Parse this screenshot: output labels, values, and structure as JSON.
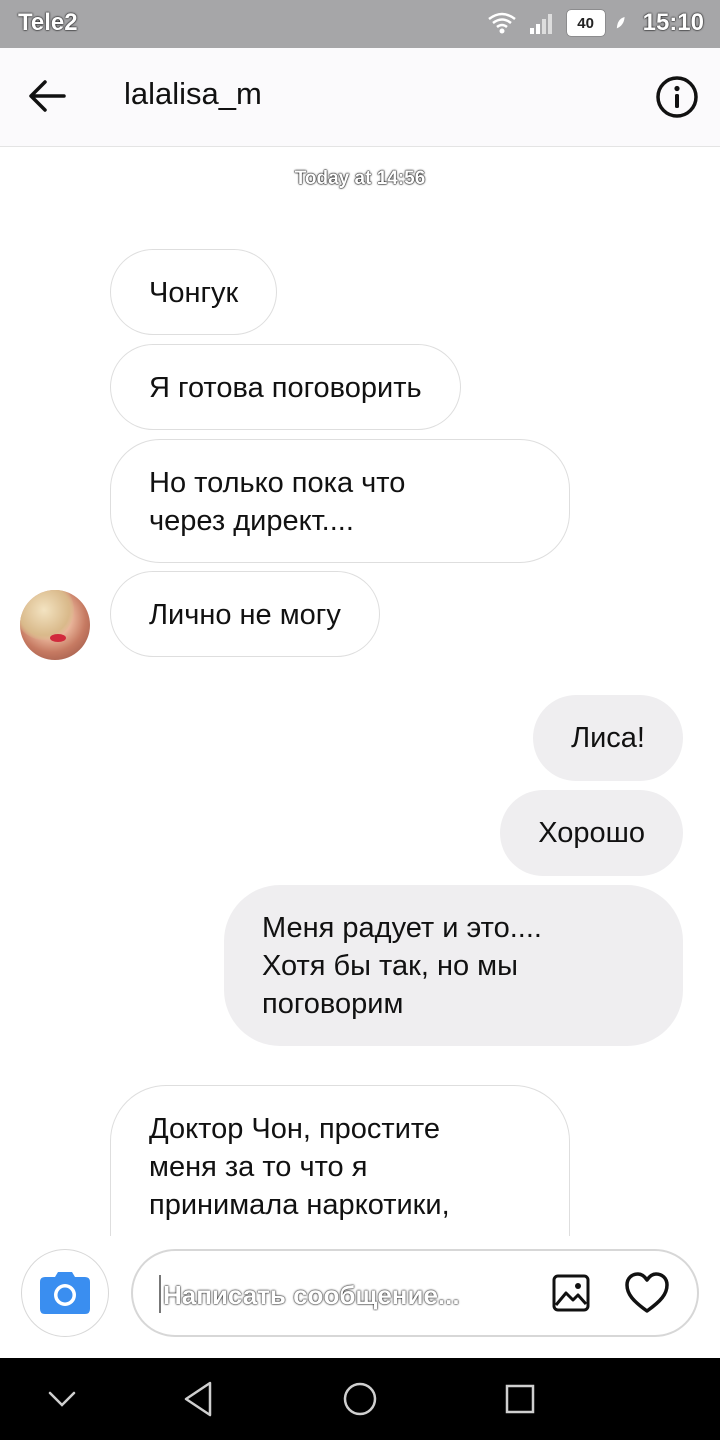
{
  "status_bar": {
    "carrier": "Tele2",
    "signal_badge": "40",
    "time": "15:10",
    "icons": [
      "wifi-icon",
      "signal-icon",
      "battery-icon",
      "leaf-icon"
    ]
  },
  "header": {
    "title": "lalalisa_m",
    "icons": [
      "back-arrow-icon",
      "info-icon"
    ]
  },
  "timestamp": "Today at 14:56",
  "messages": [
    {
      "direction": "incoming",
      "text": "Чонгук"
    },
    {
      "direction": "incoming",
      "text": "Я готова поговорить"
    },
    {
      "direction": "incoming",
      "text": "Но только пока что\nчерез директ...."
    },
    {
      "direction": "incoming",
      "text": "Лично не могу"
    },
    {
      "direction": "outgoing",
      "text": "Лиса!"
    },
    {
      "direction": "outgoing",
      "text": "Хорошо"
    },
    {
      "direction": "outgoing",
      "text": "Меня радует и это....\nХотя бы так, но мы\nпоговорим"
    },
    {
      "direction": "incoming",
      "text": "Доктор Чон, простите\nменя за то что я\nпринимала наркотики,\nперестала ходить на"
    }
  ],
  "composer": {
    "placeholder": "Написать сообщение...",
    "value": "",
    "icons": [
      "camera-icon",
      "gallery-icon",
      "heart-icon"
    ]
  },
  "navbar": {
    "icons": [
      "nav-collapse-icon",
      "nav-back-icon",
      "nav-home-icon",
      "nav-recents-icon"
    ]
  },
  "colors": {
    "status_bar": "#a6a6a8",
    "header_bg": "#fbfafc",
    "outgoing_bubble": "#efeef0",
    "incoming_border": "#dedede",
    "camera_accent": "#3a8ef0",
    "navbar": "#000000"
  }
}
